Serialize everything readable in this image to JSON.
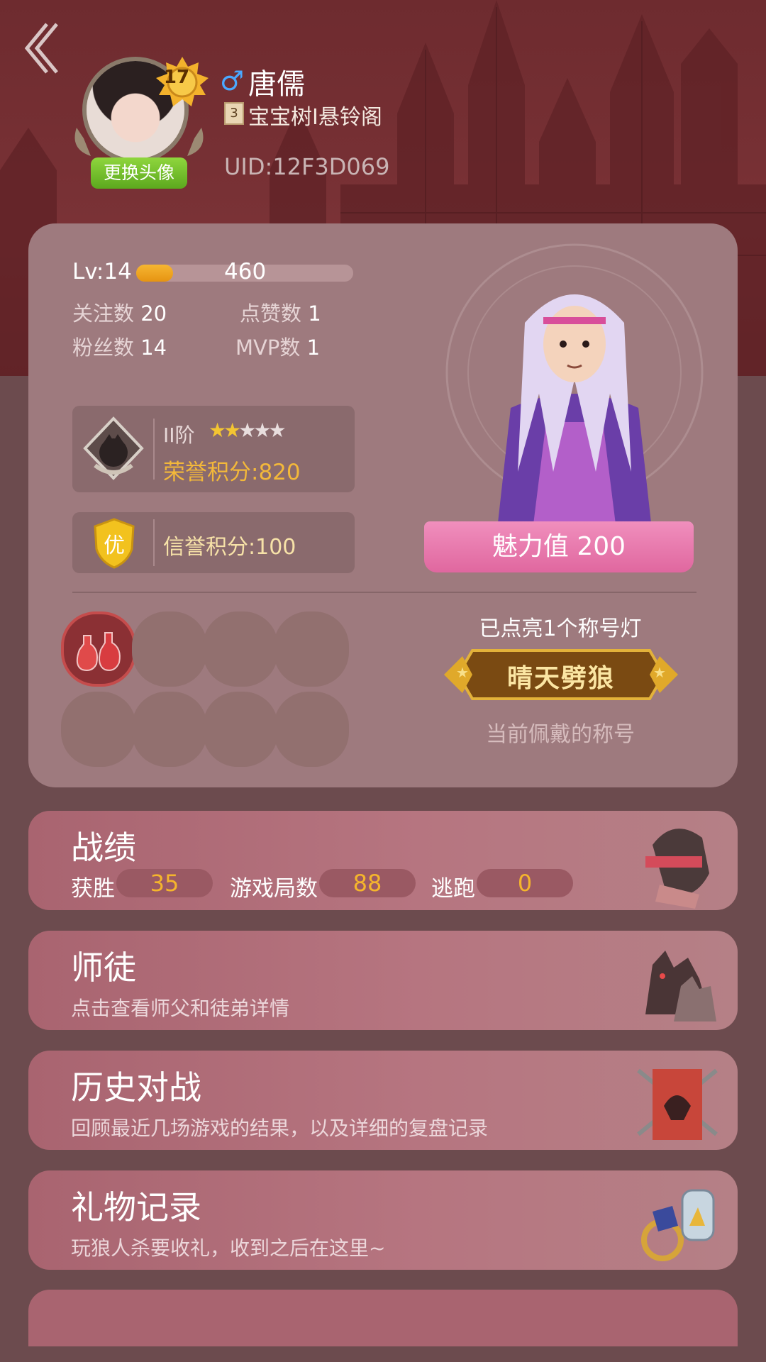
{
  "header": {
    "back_icon": "double-chevron-left-icon",
    "avatar_level": "17",
    "change_avatar_label": "更换头像",
    "gender_symbol": "♂",
    "name": "唐儒",
    "guild_rank": "3",
    "guild_name": "宝宝树I悬铃阁",
    "uid": "UID:12F3D069"
  },
  "profile": {
    "level_label": "Lv:14",
    "level_progress": 0.17,
    "exp_value": "460",
    "stats": [
      {
        "label": "关注数",
        "value": "20"
      },
      {
        "label": "点赞数",
        "value": "1"
      },
      {
        "label": "粉丝数",
        "value": "14"
      },
      {
        "label": "MVP数",
        "value": "1"
      }
    ],
    "rank": {
      "tier": "II阶",
      "stars_filled": 2,
      "stars_total": 5,
      "honor_points": "荣誉积分:820"
    },
    "credit": {
      "badge_text": "优",
      "credit_points": "信誉积分:100"
    },
    "charm": "魅力值 200",
    "lights_lit": "已点亮1个称号灯",
    "current_title": "晴天劈狼",
    "title_caption": "当前佩戴的称号"
  },
  "cards": {
    "record": {
      "title": "战绩",
      "wins_label": "获胜",
      "wins": "35",
      "games_label": "游戏局数",
      "games": "88",
      "escape_label": "逃跑",
      "escape": "0"
    },
    "mentor": {
      "title": "师徒",
      "subtitle": "点击查看师父和徒弟详情"
    },
    "history": {
      "title": "历史对战",
      "subtitle": "回顾最近几场游戏的结果，以及详细的复盘记录"
    },
    "gifts": {
      "title": "礼物记录",
      "subtitle": "玩狼人杀要收礼，收到之后在这里~"
    }
  },
  "colors": {
    "accent_gold": "#f3b83a",
    "charm_pink": "#e0679f",
    "level_bar": "#f6b632"
  }
}
